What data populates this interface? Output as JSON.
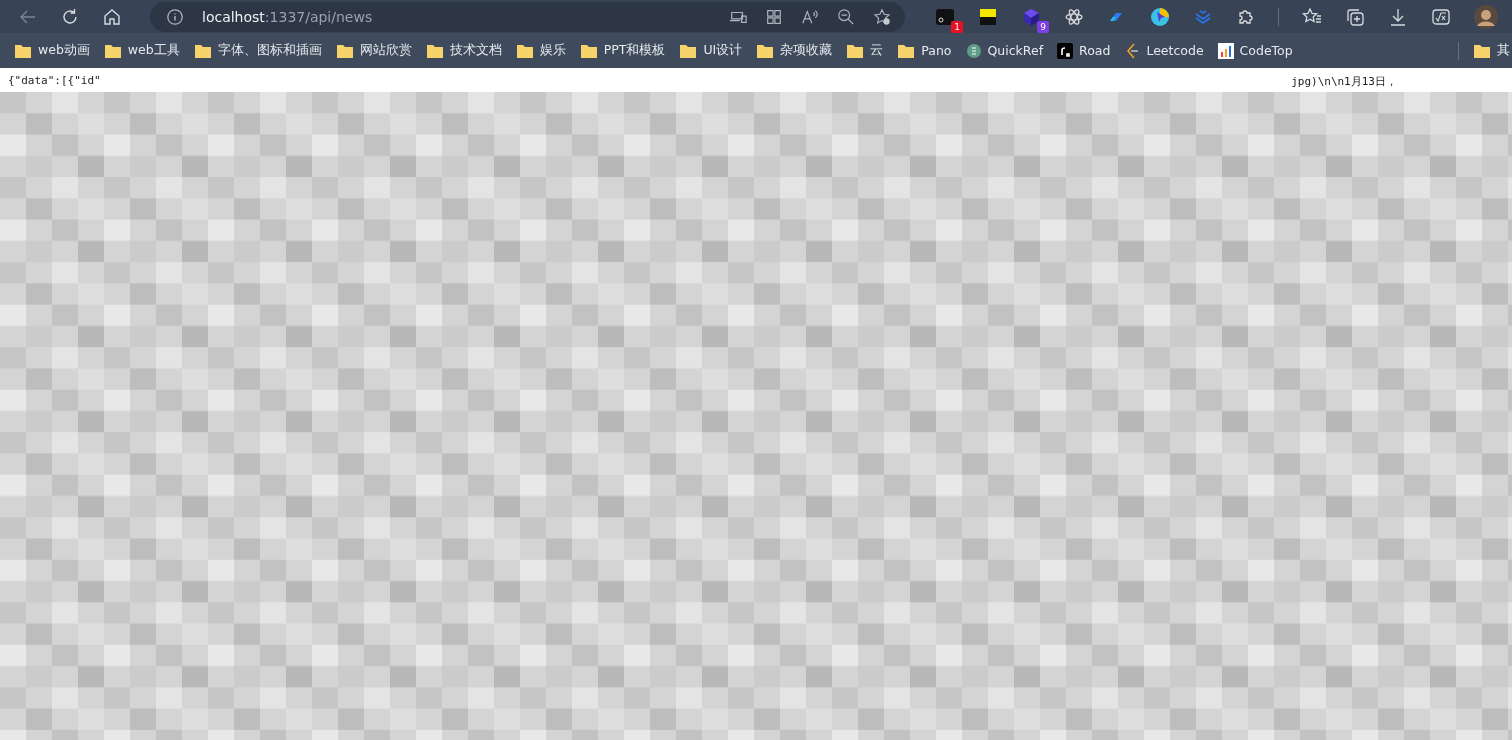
{
  "toolbar": {
    "back": {
      "disabled": true
    },
    "address": {
      "host": "localhost",
      "path": ":1337/api/news"
    },
    "address_actions": [
      {
        "kind": "device"
      },
      {
        "kind": "apps"
      },
      {
        "kind": "read"
      },
      {
        "kind": "zoom"
      },
      {
        "kind": "favorite-add"
      }
    ],
    "extensions": [
      {
        "kind": "monitor",
        "badge": "1",
        "color": "#e81123"
      },
      {
        "kind": "flag"
      },
      {
        "kind": "cube",
        "badge": "9",
        "color": "#7b3fe4"
      },
      {
        "kind": "atom"
      },
      {
        "kind": "pill"
      },
      {
        "kind": "pointer"
      },
      {
        "kind": "layers"
      },
      {
        "kind": "puzzle"
      }
    ],
    "actions": [
      {
        "kind": "favorites"
      },
      {
        "kind": "collections"
      },
      {
        "kind": "download"
      },
      {
        "kind": "math"
      },
      {
        "kind": "avatar"
      }
    ]
  },
  "bookmarks": [
    {
      "label": "web动画",
      "kind": "folder"
    },
    {
      "label": "web工具",
      "kind": "folder"
    },
    {
      "label": "字体、图标和插画",
      "kind": "folder"
    },
    {
      "label": "网站欣赏",
      "kind": "folder"
    },
    {
      "label": "技术文档",
      "kind": "folder"
    },
    {
      "label": "娱乐",
      "kind": "folder"
    },
    {
      "label": "PPT和模板",
      "kind": "folder"
    },
    {
      "label": "UI设计",
      "kind": "folder"
    },
    {
      "label": "杂项收藏",
      "kind": "folder"
    },
    {
      "label": "云",
      "kind": "folder"
    },
    {
      "label": "Pano",
      "kind": "folder"
    },
    {
      "label": "QuickRef",
      "kind": "circle"
    },
    {
      "label": "Road",
      "kind": "square"
    },
    {
      "label": "Leetcode",
      "kind": "chevron"
    },
    {
      "label": "CodeTop",
      "kind": "chart"
    }
  ],
  "other_bookmarks": {
    "label": "其"
  },
  "page": {
    "first_line": "{\"data\":[{\"id\"",
    "fragment": "jpg)\\n\\n1月13日，",
    "kind": "picture"
  }
}
